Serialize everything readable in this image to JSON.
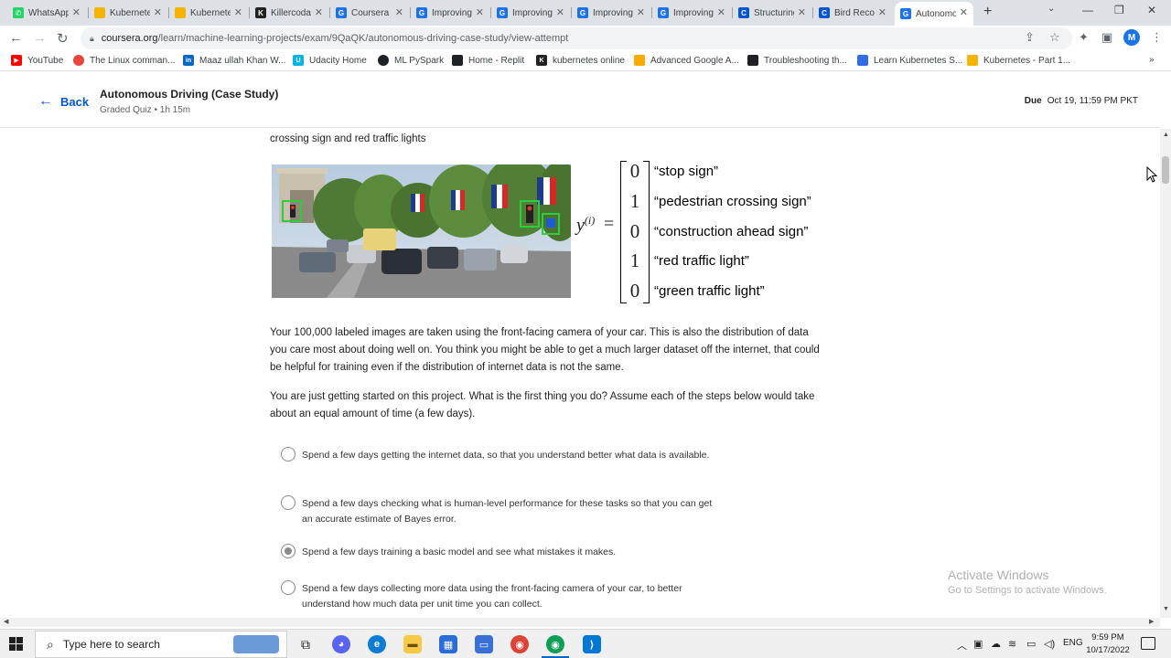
{
  "browser": {
    "tabs": [
      {
        "label": "WhatsApp",
        "icon": "whatsapp-icon",
        "color": "#25d366"
      },
      {
        "label": "Kubernetes",
        "icon": "slides-icon",
        "color": "#f4b400"
      },
      {
        "label": "Kubernetes",
        "icon": "slides-icon",
        "color": "#f4b400"
      },
      {
        "label": "Killercoda",
        "icon": "killercoda-icon",
        "color": "#222222"
      },
      {
        "label": "Coursera",
        "icon": "google-icon",
        "color": "#1a73e8"
      },
      {
        "label": "Improving",
        "icon": "google-icon",
        "color": "#1a73e8"
      },
      {
        "label": "Improving",
        "icon": "google-icon",
        "color": "#1a73e8"
      },
      {
        "label": "Improving",
        "icon": "google-icon",
        "color": "#1a73e8"
      },
      {
        "label": "Improving",
        "icon": "google-icon",
        "color": "#1a73e8"
      },
      {
        "label": "Structuring",
        "icon": "coursera-icon",
        "color": "#0056d2"
      },
      {
        "label": "Bird Recognition",
        "icon": "coursera-icon",
        "color": "#0056d2"
      },
      {
        "label": "Autonomous",
        "icon": "google-icon",
        "color": "#1a73e8"
      }
    ],
    "url_host": "coursera.org",
    "url_path": "/learn/machine-learning-projects/exam/9QaQK/autonomous-driving-case-study/view-attempt",
    "profile_initial": "M",
    "bookmarks": [
      {
        "label": "YouTube",
        "color": "#ff0000"
      },
      {
        "label": "The Linux comman...",
        "color": "#e8453c"
      },
      {
        "label": "Maaz ullah Khan W...",
        "color": "#0a66c2"
      },
      {
        "label": "Udacity Home",
        "color": "#02b3e4"
      },
      {
        "label": "ML PySpark",
        "color": "#202124"
      },
      {
        "label": "Home - Replit",
        "color": "#202124"
      },
      {
        "label": "kubernetes online",
        "color": "#222222"
      },
      {
        "label": "Advanced Google A...",
        "color": "#f9ab00"
      },
      {
        "label": "Troubleshooting th...",
        "color": "#202124"
      },
      {
        "label": "Learn Kubernetes S...",
        "color": "#326ce5"
      },
      {
        "label": "Kubernetes - Part 1...",
        "color": "#f4b400"
      }
    ]
  },
  "header": {
    "back_label": "Back",
    "title": "Autonomous Driving (Case Study)",
    "subtitle": "Graded Quiz • 1h 15m",
    "due_label": "Due",
    "due_value": "Oct 19, 11:59 PM PKT"
  },
  "content": {
    "intro_tail": "crossing sign and red traffic lights",
    "equation": {
      "symbol": "y",
      "superscript": "(i)",
      "values": [
        "0",
        "1",
        "0",
        "1",
        "0"
      ],
      "labels": [
        "“stop sign”",
        "“pedestrian crossing sign”",
        "“construction ahead sign”",
        "“red traffic light”",
        "“green traffic light”"
      ]
    },
    "paragraph1": "Your 100,000 labeled images are taken using the front-facing camera of your car. This is also the distribution of data you care most about doing well on. You think you might be able to get a much larger dataset off the internet, that could be helpful for training even if the distribution of internet data is not the same.",
    "paragraph2": "You are just getting started on this project. What is the first thing you do? Assume each of the steps below would take about an equal amount of time (a few days).",
    "options": [
      {
        "text": "Spend a few days getting the internet data, so that you understand better what data is available.",
        "selected": false
      },
      {
        "text": "Spend a few days checking what is human-level performance for these tasks so that you can get an accurate estimate of Bayes error.",
        "selected": false
      },
      {
        "text": "Spend a few days training a basic model and see what mistakes it makes.",
        "selected": true
      },
      {
        "text": "Spend a few days collecting more data using the front-facing camera of your car, to better understand how much data per unit time you can collect.",
        "selected": false
      }
    ]
  },
  "watermark": {
    "line1": "Activate Windows",
    "line2": "Go to Settings to activate Windows."
  },
  "taskbar": {
    "search_placeholder": "Type here to search",
    "language": "ENG",
    "time": "9:59 PM",
    "date": "10/17/2022"
  }
}
